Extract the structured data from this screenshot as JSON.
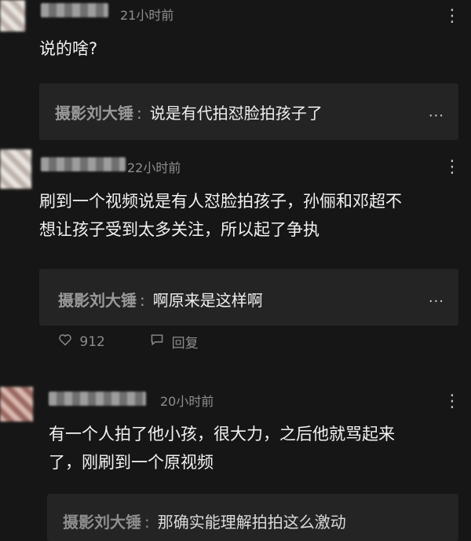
{
  "comments": [
    {
      "time": "21小时前",
      "text": "说的啥?",
      "reply": {
        "author": "摄影刘大锤",
        "colon": ":",
        "text": "说是有代拍怼脸拍孩子了",
        "more": "..."
      },
      "menu": "⋮"
    },
    {
      "time": "22小时前",
      "text_line1": "刷到一个视频说是有人怼脸拍孩子，孙俪和邓超不",
      "text_line2": "想让孩子受到太多关注，所以起了争执",
      "reply": {
        "author": "摄影刘大锤",
        "colon": ":",
        "text": "啊原来是这样啊",
        "more": "..."
      },
      "likes": "912",
      "reply_label": "回复",
      "menu": "⋮"
    },
    {
      "time": "20小时前",
      "text_line1": "有一个人拍了他小孩，很大力，之后他就骂起来",
      "text_line2": "了，刚刷到一个原视频",
      "reply": {
        "author": "摄影刘大锤",
        "colon": ":",
        "text": "那确实能理解拍拍这么激动"
      },
      "menu": "⋮"
    }
  ],
  "icons": {
    "like": "heart-outline-icon",
    "reply": "speech-bubble-icon",
    "menu": "vertical-dots-icon"
  }
}
